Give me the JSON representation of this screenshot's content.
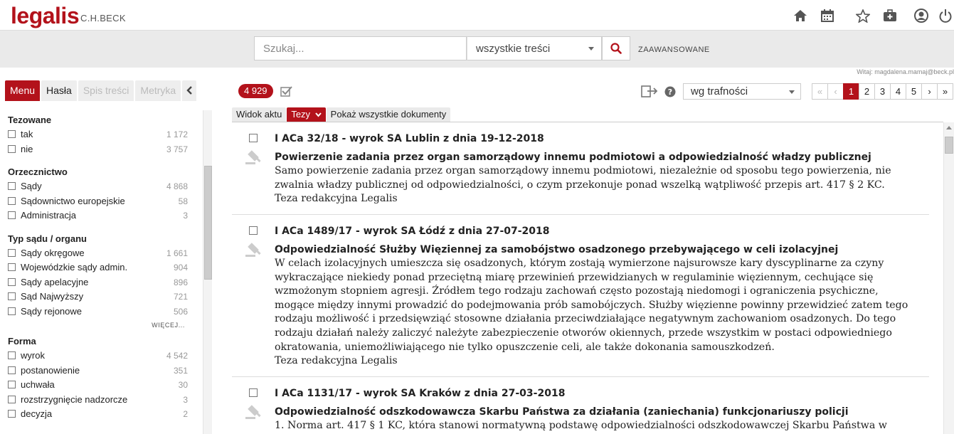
{
  "header": {
    "logo": "legalis",
    "logo_sub": "C.H.BECK",
    "icons": [
      "home-icon",
      "calendar-icon",
      "star-icon",
      "briefcase-icon",
      "user-icon",
      "power-icon"
    ]
  },
  "search": {
    "placeholder": "Szukaj...",
    "scope": "wszystkie treści",
    "advanced": "ZAAWANSOWANE"
  },
  "welcome": "Witaj: magdalena.mamaj@beck.pl",
  "left_tabs": [
    {
      "label": "Menu",
      "state": "active"
    },
    {
      "label": "Hasła",
      "state": "normal"
    },
    {
      "label": "Spis treści",
      "state": "disabled"
    },
    {
      "label": "Metryka",
      "state": "disabled"
    }
  ],
  "filters": [
    {
      "title": "Tezowane",
      "items": [
        {
          "label": "tak",
          "count": "1 172"
        },
        {
          "label": "nie",
          "count": "3 757"
        }
      ]
    },
    {
      "title": "Orzecznictwo",
      "items": [
        {
          "label": "Sądy",
          "count": "4 868"
        },
        {
          "label": "Sądownictwo europejskie",
          "count": "58"
        },
        {
          "label": "Administracja",
          "count": "3"
        }
      ]
    },
    {
      "title": "Typ sądu / organu",
      "items": [
        {
          "label": "Sądy okręgowe",
          "count": "1 661"
        },
        {
          "label": "Wojewódzkie sądy admin.",
          "count": "904"
        },
        {
          "label": "Sądy apelacyjne",
          "count": "896"
        },
        {
          "label": "Sąd Najwyższy",
          "count": "721"
        },
        {
          "label": "Sądy rejonowe",
          "count": "506"
        }
      ],
      "more": "WIĘCEJ..."
    },
    {
      "title": "Forma",
      "items": [
        {
          "label": "wyrok",
          "count": "4 542"
        },
        {
          "label": "postanowienie",
          "count": "351"
        },
        {
          "label": "uchwała",
          "count": "30"
        },
        {
          "label": "rozstrzygnięcie nadzorcze",
          "count": "3"
        },
        {
          "label": "decyzja",
          "count": "2"
        }
      ]
    }
  ],
  "results_bar": {
    "count": "4 929",
    "sort": "wg trafności",
    "pages": [
      "«",
      "‹",
      "1",
      "2",
      "3",
      "4",
      "5",
      "›",
      "»"
    ],
    "current_page": "1"
  },
  "view_tabs": [
    {
      "label": "Widok aktu",
      "active": false
    },
    {
      "label": "Tezy",
      "active": true
    },
    {
      "label": "Pokaż wszystkie dokumenty",
      "active": false
    }
  ],
  "results": [
    {
      "signature": "I ACa 32/18 - wyrok SA Lublin z dnia 19-12-2018",
      "title": "Powierzenie zadania przez organ samorządowy innemu podmiotowi a odpowiedzialność władzy publicznej",
      "text": "Samo powierzenie zadania przez organ samorządowy innemu podmiotowi, niezależnie od sposobu tego powierzenia, nie zwalnia władzy publicznej od odpowiedzialności, o czym przekonuje ponad wszelką wątpliwość przepis art. 417 § 2 KC.",
      "footer": "Teza redakcyjna Legalis"
    },
    {
      "signature": "I ACa 1489/17 - wyrok SA Łódź z dnia 27-07-2018",
      "title": "Odpowiedzialność Służby Więziennej za samobójstwo osadzonego przebywającego w celi izolacyjnej",
      "text": "W celach izolacyjnych umieszcza się osadzonych, którym zostają wymierzone najsurowsze kary dyscyplinarne za czyny wykraczające niekiedy ponad przeciętną miarę przewinień przewidzianych w regulaminie więziennym, cechujące się wzmożonym stopniem agresji. Źródłem tego rodzaju zachowań często pozostają niedomogi i ograniczenia psychiczne, mogące między innymi prowadzić do podejmowania prób samobójczych. Służby więzienne powinny przewidzieć zatem tego rodzaju możliwość i przedsięwziąć stosowne działania przeciwdziałające negatywnym zachowaniom osadzonych. Do tego rodzaju działań należy zaliczyć należyte zabezpieczenie otworów okiennych, przede wszystkim w postaci odpowiedniego okratowania, uniemożliwiającego nie tylko opuszczenie celi, ale także dokonania samouszkodzeń.",
      "footer": "Teza redakcyjna Legalis"
    },
    {
      "signature": "I ACa 1131/17 - wyrok SA Kraków z dnia 27-03-2018",
      "title": "Odpowiedzialność odszkodowawcza Skarbu Państwa za działania (zaniechania) funkcjonariuszy policji",
      "text": "1. Norma art. 417 § 1 KC, która stanowi normatywną podstawę odpowiedzialności odszkodowawczej Skarbu Państwa w",
      "footer": ""
    }
  ],
  "colors": {
    "brand": "#b3121b",
    "bar": "#eaeaea"
  }
}
